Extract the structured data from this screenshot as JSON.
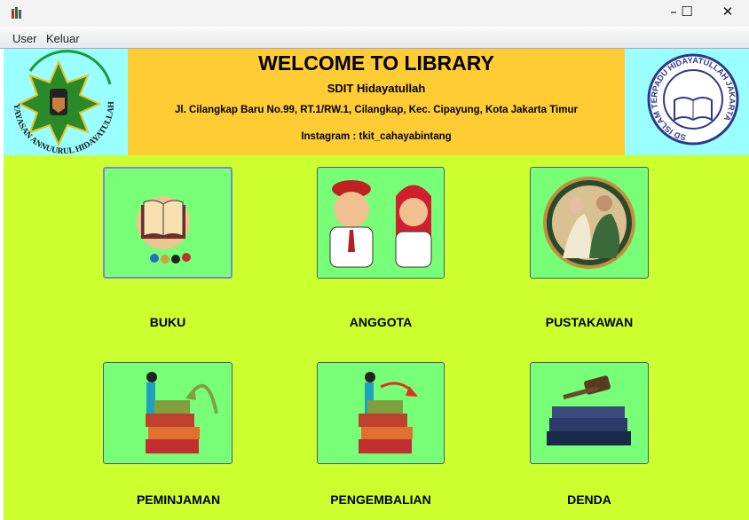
{
  "menu": {
    "items": [
      "User",
      "Keluar"
    ]
  },
  "window": {
    "minimize": "–",
    "maximize": "☐",
    "close": "✕"
  },
  "header": {
    "title": "WELCOME TO LIBRARY",
    "school": "SDIT Hidayatullah",
    "address": "Jl. Cilangkap Baru No.99, RT.1/RW.1, Cilangkap, Kec. Cipayung, Kota Jakarta Timur",
    "instagram": "Instagram : tkit_cahayabintang",
    "left_logo_text": "YAYASAN ANNUURUL HIDAYATULLAH",
    "right_logo_text": "SD ISLAM TERPADU HIDAYATULLAH JAKARTA"
  },
  "tiles": [
    {
      "label": "BUKU",
      "icon": "book-icon"
    },
    {
      "label": "ANGGOTA",
      "icon": "students-icon"
    },
    {
      "label": "PUSTAKAWAN",
      "icon": "librarian-icon"
    },
    {
      "label": "PEMINJAMAN",
      "icon": "borrow-icon"
    },
    {
      "label": "PENGEMBALIAN",
      "icon": "return-icon"
    },
    {
      "label": "DENDA",
      "icon": "gavel-icon"
    }
  ]
}
